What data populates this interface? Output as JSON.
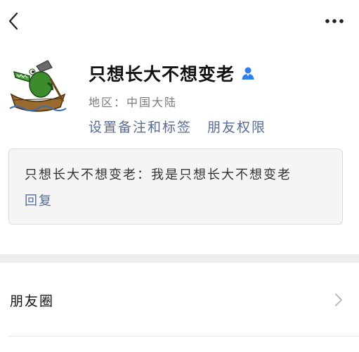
{
  "header": {
    "back_icon": "chevron-left-icon",
    "more_icon": "more-dots-icon"
  },
  "profile": {
    "nickname": "只想长大不想变老",
    "gender_icon": "male-user-icon",
    "gender_color": "#2f80ed",
    "region": "地区：中国大陆",
    "links": {
      "remarks_tags": "设置备注和标签",
      "permissions": "朋友权限"
    },
    "link_color": "#576b95"
  },
  "greeting": {
    "message": "只想长大不想变老：我是只想长大不想变老",
    "reply": "回复"
  },
  "menu": {
    "moments": "朋友圈"
  }
}
